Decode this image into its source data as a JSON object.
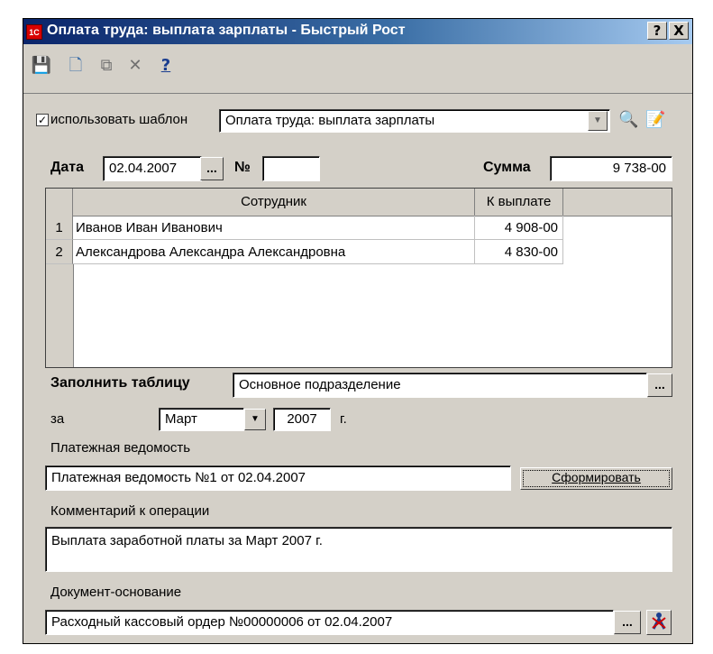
{
  "window": {
    "title": "Оплата труда: выплата зарплаты - Быстрый Рост",
    "app_icon_text": "1С",
    "help_label": "?",
    "close_label": "X"
  },
  "toolbar": {
    "icons": [
      "save-icon",
      "new-document-icon",
      "copy-icon",
      "delete-icon",
      "help-icon"
    ],
    "glyphs": {
      "save": "💾",
      "new": "🗋",
      "copy": "⧉",
      "delete": "✕",
      "help": "?"
    }
  },
  "template": {
    "checked": true,
    "check_glyph": "✓",
    "label": "использовать шаблон",
    "value": "Оплата труда: выплата зарплаты"
  },
  "header": {
    "date_label": "Дата",
    "date_value": "02.04.2007",
    "date_button": "...",
    "number_label": "№",
    "number_value": "",
    "sum_label": "Сумма",
    "sum_value": "9 738-00"
  },
  "table": {
    "columns": [
      "Сотрудник",
      "К выплате"
    ],
    "rows": [
      {
        "num": "1",
        "employee": "Иванов Иван Иванович",
        "amount": "4 908-00"
      },
      {
        "num": "2",
        "employee": "Александрова Александра Александровна",
        "amount": "4 830-00"
      }
    ]
  },
  "fill": {
    "label": "Заполнить таблицу",
    "value": "Основное подразделение",
    "button": "..."
  },
  "period": {
    "label": "за",
    "month": "Март",
    "year": "2007",
    "suffix": "г."
  },
  "payroll": {
    "label": "Платежная ведомость",
    "value": "Платежная ведомость №1 от 02.04.2007",
    "button": "Сформировать"
  },
  "comment": {
    "label": "Комментарий к операции",
    "value": "Выплата заработной платы за Март 2007 г."
  },
  "base_doc": {
    "label": "Документ-основание",
    "value": "Расходный кассовый ордер №00000006 от 02.04.2007",
    "button": "..."
  }
}
